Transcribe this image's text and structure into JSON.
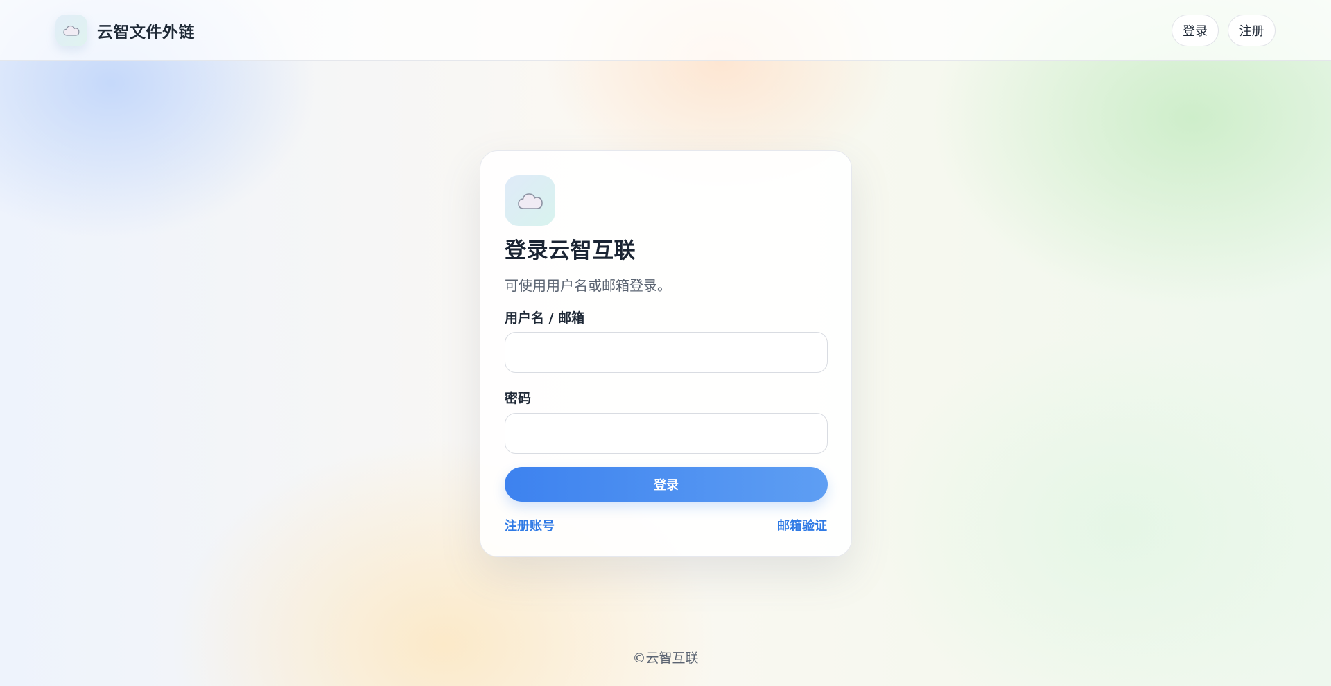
{
  "header": {
    "brand_icon": "cloud-icon",
    "brand_name": "云智文件外链",
    "nav": {
      "login_label": "登录",
      "register_label": "注册"
    }
  },
  "login_card": {
    "icon": "cloud-icon",
    "title": "登录云智互联",
    "subtitle": "可使用用户名或邮箱登录。",
    "username_label": "用户名 / 邮箱",
    "username_value": "",
    "username_placeholder": "",
    "password_label": "密码",
    "password_value": "",
    "password_placeholder": "",
    "submit_label": "登录",
    "register_link": "注册账号",
    "verify_link": "邮箱验证"
  },
  "footer": {
    "copyright": "©云智互联"
  },
  "colors": {
    "accent": "#3d82ef",
    "link": "#2f7ae5",
    "title_text": "#1a2433",
    "muted_text": "#5b6472"
  }
}
